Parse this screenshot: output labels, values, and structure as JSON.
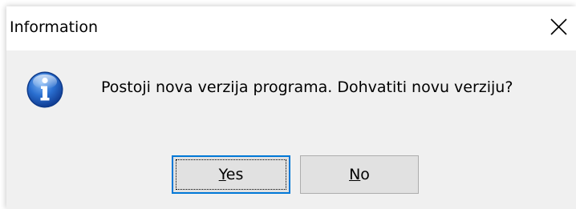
{
  "window": {
    "title": "Information",
    "close_icon": "close-icon"
  },
  "content": {
    "icon": "info-icon",
    "message": "Postoji nova verzija programa. Dohvatiti novu verziju?"
  },
  "buttons": {
    "yes": {
      "mnemonic": "Y",
      "rest": "es",
      "label": "Yes",
      "focused": true
    },
    "no": {
      "mnemonic": "N",
      "rest": "o",
      "label": "No",
      "focused": false
    }
  },
  "colors": {
    "dialog_bg": "#f0f0f0",
    "titlebar_bg": "#ffffff",
    "button_bg": "#e1e1e1",
    "button_border": "#adadad",
    "focus_border": "#0078d7",
    "icon_blue": "#1f5fc4"
  }
}
